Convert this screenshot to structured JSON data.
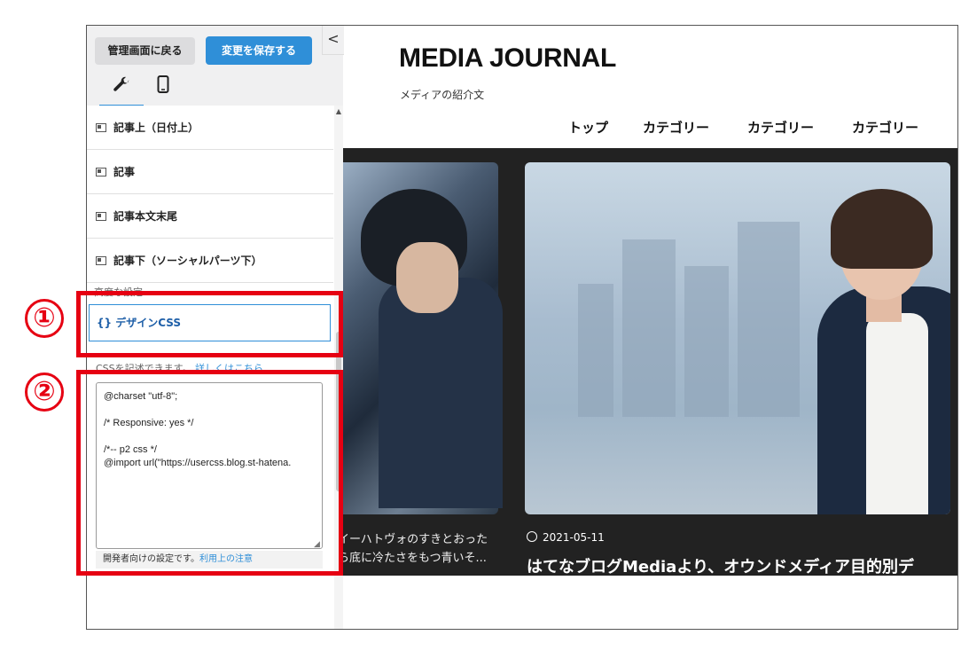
{
  "sidebar": {
    "back_button": "管理画面に戻る",
    "save_button": "変更を保存する",
    "collapse_glyph": "<",
    "tabs": [
      {
        "icon": "wrench-icon",
        "active": true
      },
      {
        "icon": "mobile-icon",
        "active": false
      }
    ],
    "items": [
      {
        "label": "記事上（日付上）"
      },
      {
        "label": "記事"
      },
      {
        "label": "記事本文末尾"
      },
      {
        "label": "記事下（ソーシャルパーツ下）"
      }
    ],
    "section_label": "高度な設定",
    "css_item": {
      "icon_text": "{}",
      "label": "デザインCSS"
    },
    "css_help_plain": "CSSを記述できます。",
    "css_help_link": "詳しくはこちら",
    "editor_value": "@charset \"utf-8\";\n\n/* Responsive: yes */\n\n/*-- p2 css */\n@import url(\"https://usercss.blog.st-hatena.",
    "dev_note_plain": "開発者向けの設定です。",
    "dev_note_link": "利用上の注意"
  },
  "preview": {
    "site_title": "MEDIA JOURNAL",
    "site_description": "メディアの紹介文",
    "nav": [
      "トップ",
      "カテゴリー",
      "カテゴリー",
      "カテゴリー"
    ],
    "left_post_lines": [
      "イーハトヴォのすきとおった",
      "ら底に冷たさをもつ青いそ..."
    ],
    "right_post": {
      "date": "2021-05-11",
      "title": "はてなブログMediaより、オウンドメディア目的別デ"
    }
  },
  "annotations": {
    "marker_1": "①",
    "marker_2": "②"
  },
  "colors": {
    "accent": "#2f8fd8",
    "annotation_red": "#e60012",
    "dark_bg": "#222222"
  }
}
